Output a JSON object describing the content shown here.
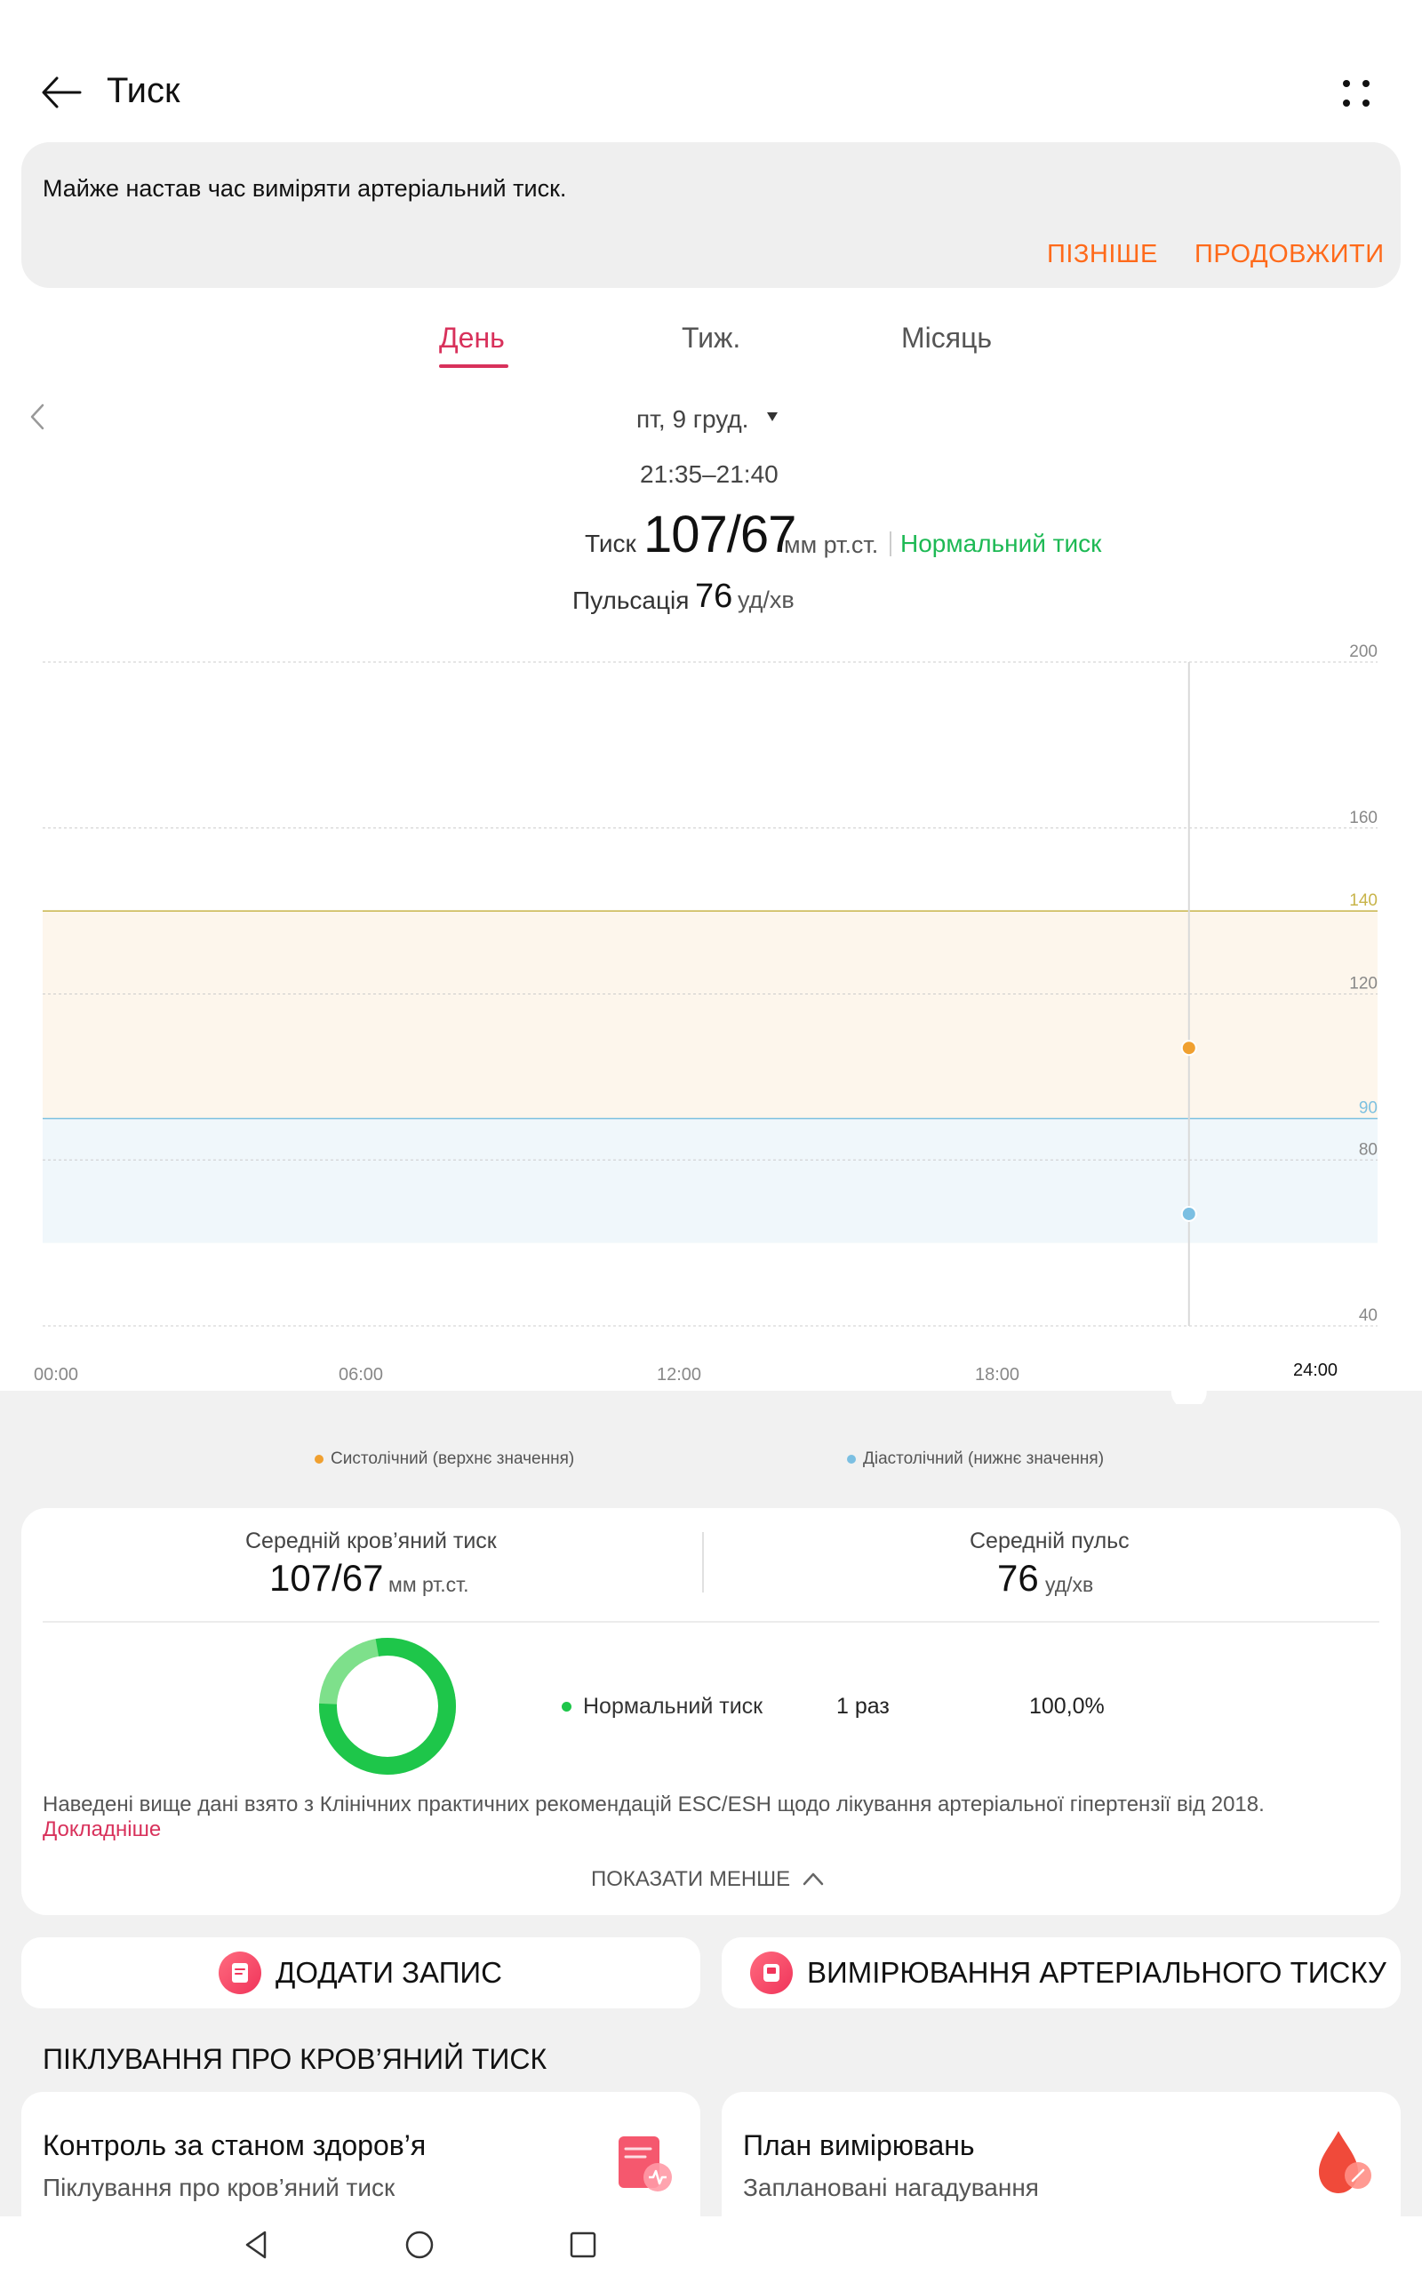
{
  "header": {
    "title": "Тиск"
  },
  "reminder": {
    "text": "Майже настав час виміряти артеріальний тиск.",
    "later_label": "ПІЗНІШЕ",
    "continue_label": "ПРОДОВЖИТИ"
  },
  "tabs": [
    {
      "label": "День",
      "selected": true
    },
    {
      "label": "Тиж.",
      "selected": false
    },
    {
      "label": "Місяць",
      "selected": false
    }
  ],
  "date": {
    "label": "пт, 9 груд.",
    "time_range": "21:35–21:40"
  },
  "reading": {
    "bp_label": "Тиск",
    "bp_value": "107/67",
    "bp_unit": "мм рт.ст.",
    "status": "Нормальний тиск",
    "pulse_label": "Пульсація",
    "pulse_value": "76",
    "pulse_unit": "уд/хв"
  },
  "chart_data": {
    "type": "scatter",
    "x_ticks": [
      "00:00",
      "06:00",
      "12:00",
      "18:00",
      "24:00"
    ],
    "y_ticks": [
      200,
      160,
      140,
      120,
      90,
      80,
      40
    ],
    "ylim": [
      40,
      200
    ],
    "thresholds": [
      {
        "value": 140,
        "color": "#c8b44a"
      },
      {
        "value": 90,
        "color": "#7ec1e0"
      }
    ],
    "series": [
      {
        "name": "Систолічний (верхнє значення)",
        "color": "#f0a030",
        "points": [
          {
            "x": "21:37",
            "y": 107
          }
        ]
      },
      {
        "name": "Діастолічний (нижнє значення)",
        "color": "#7bbfe2",
        "points": [
          {
            "x": "21:37",
            "y": 67
          }
        ]
      }
    ],
    "grid": true
  },
  "legend": {
    "systolic": "Систолічний (верхнє значення)",
    "diastolic": "Діастолічний (нижнє значення)"
  },
  "summary": {
    "avg_bp_label": "Середній кров’яний тиск",
    "avg_bp_value": "107/67",
    "avg_bp_unit": "мм рт.ст.",
    "avg_pulse_label": "Середній пульс",
    "avg_pulse_value": "76",
    "avg_pulse_unit": "уд/хв",
    "stat_name": "Нормальний тиск",
    "stat_count": "1 раз",
    "stat_percent": "100,0%",
    "disclaimer": "Наведені вище дані взято з Клінічних практичних рекомендацій ESC/ESH щодо лікування артеріальної гіпертензії від 2018.",
    "more_link": "Докладніше",
    "show_less": "ПОКАЗАТИ МЕНШЕ"
  },
  "actions": {
    "add_record": "ДОДАТИ ЗАПИС",
    "measure_bp": "ВИМІРЮВАННЯ АРТЕРІАЛЬНОГО ТИСКУ"
  },
  "care": {
    "heading": "ПІКЛУВАННЯ ПРО КРОВ’ЯНИЙ ТИСК",
    "health_title": "Контроль за станом здоров’я",
    "health_sub": "Піклування про кров’яний тиск",
    "plan_title": "План вимірювань",
    "plan_sub": "Заплановані нагадування"
  },
  "colors": {
    "accent": "#d8315b",
    "orange": "#ff6a1a",
    "normal_green": "#1db954"
  }
}
